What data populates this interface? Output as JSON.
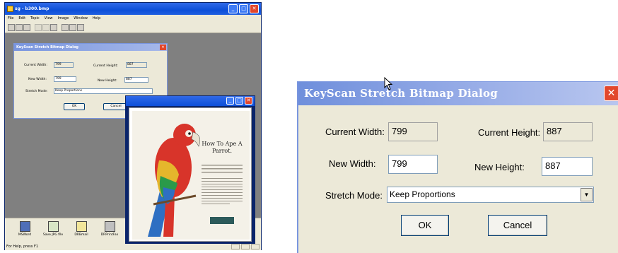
{
  "app": {
    "title": "sg - b300.bmp",
    "menu": [
      "File",
      "Edit",
      "Topic",
      "View",
      "Image",
      "Window",
      "Help"
    ],
    "status": "For Help, press F1",
    "bottom_icons": [
      "MSWord",
      "Save JPG file",
      "DRBmail",
      "DRPrintFax"
    ]
  },
  "small_dialog": {
    "title": "KeyScan Stretch Bitmap Dialog",
    "current_width_label": "Current Width:",
    "current_width": "799",
    "current_height_label": "Current Height:",
    "current_height": "887",
    "new_width_label": "New Width:",
    "new_width": "799",
    "new_height_label": "New Height:",
    "new_height": "887",
    "stretch_label": "Stretch Mode:",
    "stretch_value": "Keep Proportions",
    "ok": "OK",
    "cancel": "Cancel"
  },
  "image_window": {
    "poster_title": "How To Ape A Parrot."
  },
  "dialog": {
    "title": "KeyScan Stretch Bitmap Dialog",
    "close": "✕",
    "current_width_label": "Current Width:",
    "current_width": "799",
    "current_height_label": "Current Height:",
    "current_height": "887",
    "new_width_label": "New Width:",
    "new_width": "799",
    "new_height_label": "New Height:",
    "new_height": "887",
    "stretch_label": "Stretch Mode:",
    "stretch_value": "Keep Proportions",
    "ok": "OK",
    "cancel": "Cancel"
  },
  "colors": {
    "xp_title_blue": "#0d4fd8",
    "dialog_title": "#7a96df",
    "dialog_bg": "#ece9d8",
    "close_red": "#e2472c",
    "workspace_gray": "#808080"
  }
}
